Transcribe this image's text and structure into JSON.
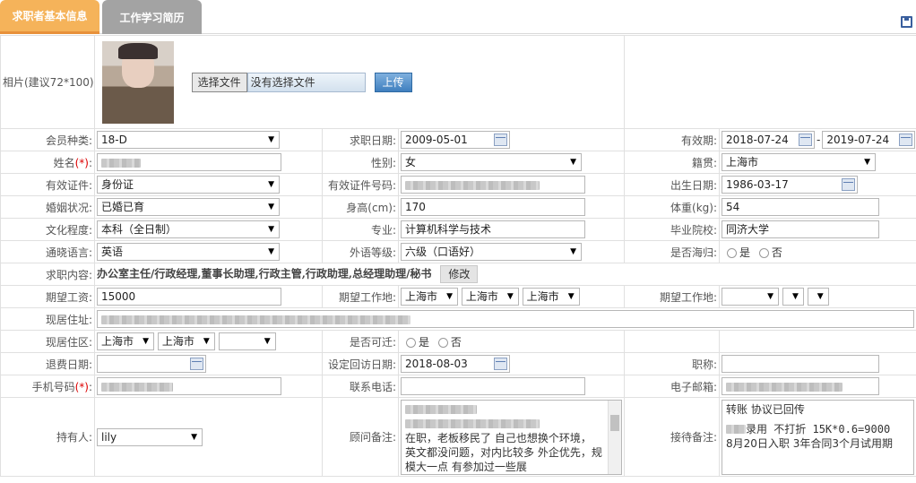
{
  "tabs": [
    {
      "label": "求职者基本信息"
    },
    {
      "label": "工作学习简历"
    }
  ],
  "colors": {
    "tab_active": "#f5b35a",
    "tab_inactive": "#a3a3a3",
    "required": "#dd0000"
  },
  "photo": {
    "label": "相片(建议72*100):",
    "choose_label": "选择文件",
    "status": "没有选择文件",
    "upload_label": "上传"
  },
  "fields": {
    "member_type": {
      "label": "会员种类:",
      "value": "18-D"
    },
    "job_date": {
      "label": "求职日期:",
      "value": "2009-05-01"
    },
    "valid_period": {
      "label": "有效期:",
      "start": "2018-07-24",
      "sep": "-",
      "end": "2019-07-24"
    },
    "name": {
      "label": "姓名",
      "req": "(*)",
      "colon": ":"
    },
    "gender": {
      "label": "性别:",
      "value": "女"
    },
    "native": {
      "label": "籍贯:",
      "value": "上海市"
    },
    "id_type": {
      "label": "有效证件:",
      "value": "身份证"
    },
    "id_no": {
      "label": "有效证件号码:"
    },
    "birth": {
      "label": "出生日期:",
      "value": "1986-03-17"
    },
    "marital": {
      "label": "婚姻状况:",
      "value": "已婚已育"
    },
    "height": {
      "label": "身高(cm):",
      "value": "170"
    },
    "weight": {
      "label": "体重(kg):",
      "value": "54"
    },
    "education": {
      "label": "文化程度:",
      "value": "本科（全日制）"
    },
    "major": {
      "label": "专业:",
      "value": "计算机科学与技术"
    },
    "school": {
      "label": "毕业院校:",
      "value": "同济大学"
    },
    "language": {
      "label": "通晓语言:",
      "value": "英语"
    },
    "lang_level": {
      "label": "外语等级:",
      "value": "六级（口语好）"
    },
    "overseas": {
      "label": "是否海归:",
      "yes": "是",
      "no": "否"
    },
    "job_content": {
      "label": "求职内容:",
      "value": "办公室主任/行政经理,董事长助理,行政主管,行政助理,总经理助理/秘书",
      "edit_label": "修改"
    },
    "salary": {
      "label": "期望工资:",
      "value": "15000"
    },
    "work_place": {
      "label": "期望工作地:",
      "v1": "上海市",
      "v2": "上海市",
      "v3": "上海市"
    },
    "work_place2": {
      "label": "期望工作地:"
    },
    "address": {
      "label": "现居住址:"
    },
    "district": {
      "label": "现居住区:",
      "v1": "上海市",
      "v2": "上海市"
    },
    "relocate": {
      "label": "是否可迁:",
      "yes": "是",
      "no": "否"
    },
    "refund_date": {
      "label": "退费日期:"
    },
    "visit_date": {
      "label": "设定回访日期:",
      "value": "2018-08-03"
    },
    "title": {
      "label": "职称:"
    },
    "mobile": {
      "label": "手机号码",
      "req": "(*)",
      "colon": ":"
    },
    "phone": {
      "label": "联系电话:"
    },
    "email": {
      "label": "电子邮箱:"
    },
    "holder": {
      "label": "持有人:",
      "value": "lily"
    },
    "advisor_note": {
      "label": "顾问备注:",
      "text": "在职，老板移民了 自己也想换个环境， 英文都没问题，对内比较多 外企优先，规模大一点 有参加过一些展"
    },
    "reception_note": {
      "label": "接待备注:",
      "line1": "转账 协议已回传",
      "line2": "录用 不打折 15K*0.6=9000",
      "line3": "8月20日入职  3年合同3个月试用期"
    }
  }
}
